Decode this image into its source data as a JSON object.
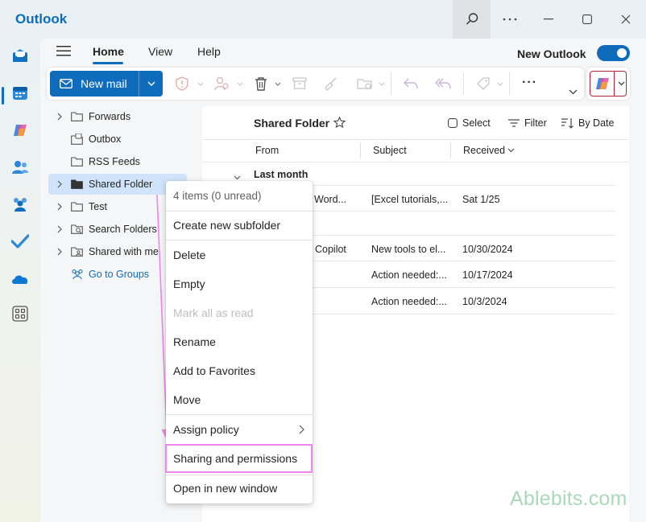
{
  "app": {
    "title": "Outlook"
  },
  "tabs": [
    {
      "label": "Home",
      "active": true
    },
    {
      "label": "View",
      "active": false
    },
    {
      "label": "Help",
      "active": false
    }
  ],
  "new_outlook": {
    "label": "New Outlook",
    "enabled": true
  },
  "ribbon": {
    "new_mail_label": "New mail",
    "more_label": "···"
  },
  "folders": [
    {
      "label": "Forwards",
      "icon": "folder-icon",
      "expandable": true
    },
    {
      "label": "Outbox",
      "icon": "outbox-icon",
      "expandable": false
    },
    {
      "label": "RSS Feeds",
      "icon": "folder-icon",
      "expandable": false
    },
    {
      "label": "Shared Folder",
      "icon": "folder-filled-icon",
      "expandable": true,
      "selected": true
    },
    {
      "label": "Test",
      "icon": "folder-icon",
      "expandable": true
    },
    {
      "label": "Search Folders",
      "icon": "search-folder-icon",
      "expandable": true
    },
    {
      "label": "Shared with me",
      "icon": "shared-folder-icon",
      "expandable": true
    },
    {
      "label": "Go to Groups",
      "icon": "groups-icon",
      "expandable": false,
      "link": true
    }
  ],
  "mail_list": {
    "title": "Shared Folder",
    "actions": {
      "select": "Select",
      "filter": "Filter",
      "sort": "By Date"
    },
    "columns": {
      "from": "From",
      "subject": "Subject",
      "received": "Received"
    },
    "group_label": "Last month",
    "rows": [
      {
        "from": "Word...",
        "subject": "[Excel tutorials,...",
        "received": "Sat 1/25"
      },
      {
        "from": "Copilot",
        "subject": "New tools to el...",
        "received": "10/30/2024"
      },
      {
        "from": "",
        "subject": "Action needed:...",
        "received": "10/17/2024"
      },
      {
        "from": "",
        "subject": "Action needed:...",
        "received": "10/3/2024"
      }
    ]
  },
  "context_menu": {
    "header": "4 items (0 unread)",
    "items": {
      "create_subfolder": "Create new subfolder",
      "delete": "Delete",
      "empty": "Empty",
      "mark_all_read": "Mark all as read",
      "rename": "Rename",
      "add_favorites": "Add to Favorites",
      "move": "Move",
      "assign_policy": "Assign policy",
      "sharing": "Sharing and permissions",
      "open_new_window": "Open in new window"
    }
  },
  "watermark": {
    "brand": "Ablebits",
    "suffix": ".com"
  },
  "colors": {
    "accent": "#0f6cbd",
    "highlight": "#ef86ef",
    "watermark": "#a9d9b7"
  }
}
